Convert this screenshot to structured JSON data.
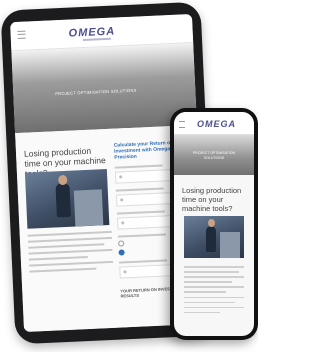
{
  "tablet": {
    "logo": "OMEGA",
    "hero_text": "PROJECT OPTIMISATION SOLUTIONS",
    "heading": "Losing production time on your machine tools?",
    "form_title": "Calculate your Return on Investment with Omega Precision",
    "result_label": "YOUR RETURN ON INVESTMENT RESULTS"
  },
  "phone": {
    "logo": "OMEGA",
    "hero_text": "PROJECT OPTIMISATION SOLUTIONS",
    "heading": "Losing production time on your machine tools?"
  },
  "colors": {
    "brand": "#4b4f8f",
    "accent": "#2f6fb6"
  }
}
